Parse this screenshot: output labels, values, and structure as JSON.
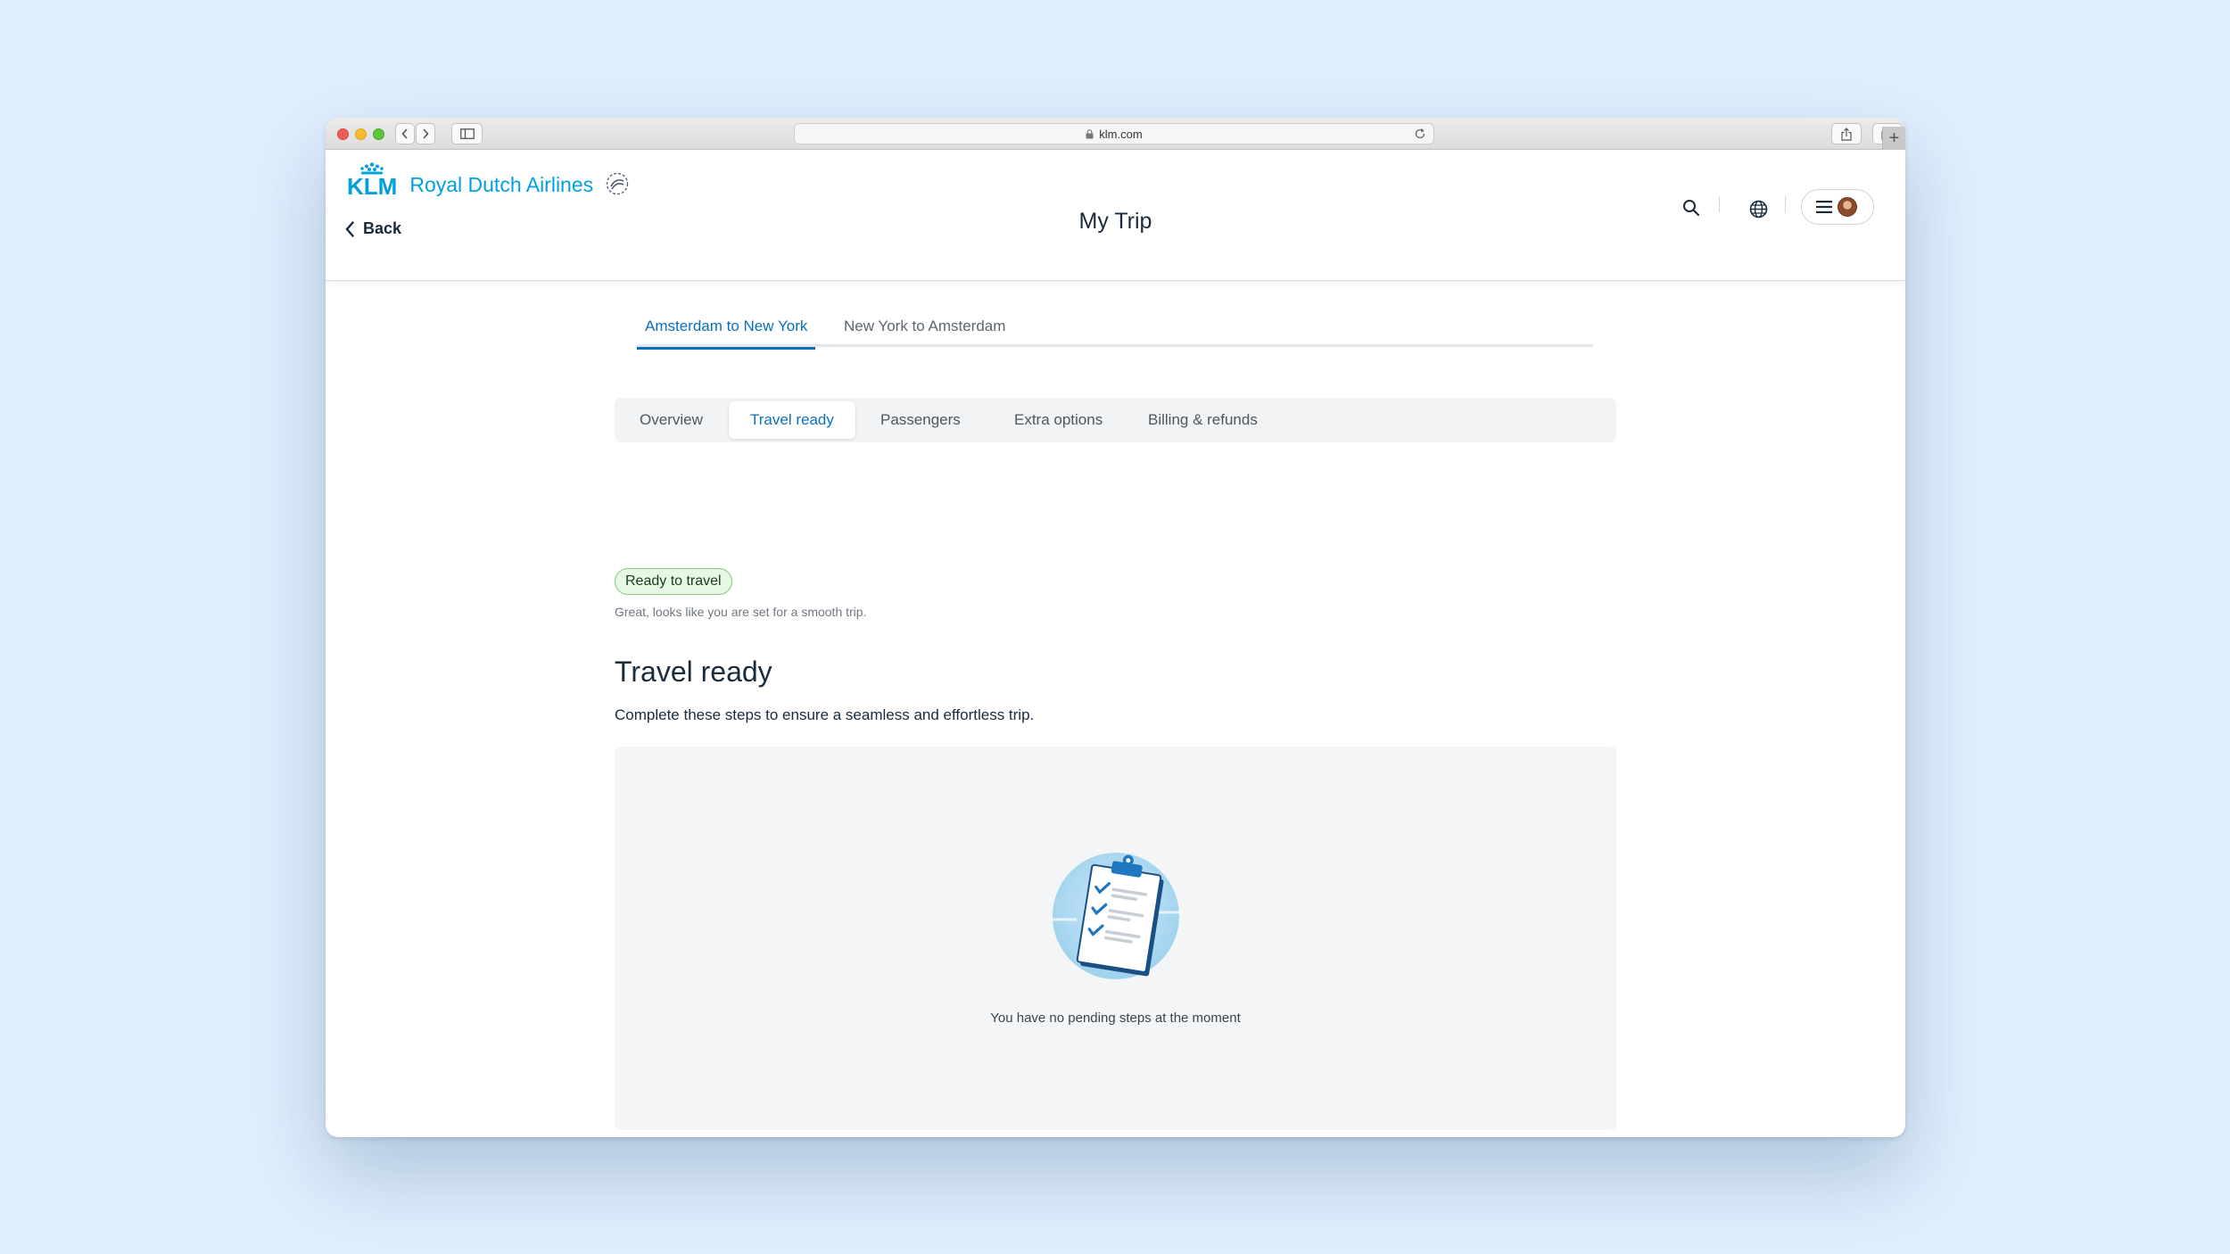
{
  "browser": {
    "url": "klm.com"
  },
  "brand": {
    "logo_text": "KLM",
    "name": "Royal Dutch Airlines",
    "color": "#00a1de"
  },
  "header": {
    "back_label": "Back",
    "title": "My Trip"
  },
  "route_tabs": [
    {
      "label": "Amsterdam to New York",
      "active": true
    },
    {
      "label": "New York to Amsterdam",
      "active": false
    }
  ],
  "sub_tabs": [
    {
      "label": "Overview",
      "active": false
    },
    {
      "label": "Travel ready",
      "active": true
    },
    {
      "label": "Passengers",
      "active": false
    },
    {
      "label": "Extra options",
      "active": false
    },
    {
      "label": "Billing & refunds",
      "active": false
    }
  ],
  "status": {
    "badge": "Ready to travel",
    "subtitle": "Great, looks like you are set for a smooth trip."
  },
  "section": {
    "title": "Travel ready",
    "description": "Complete these steps to ensure a seamless and effortless trip.",
    "empty_message": "You have no pending steps at the moment"
  },
  "colors": {
    "accent": "#0a70be",
    "badge_bg": "#e6f8e4",
    "badge_border": "#7ccd76",
    "page_background": "#e0effd"
  },
  "icons": [
    "search-icon",
    "globe-icon",
    "hamburger-icon",
    "chevron-left-icon",
    "clipboard-checklist-icon"
  ]
}
